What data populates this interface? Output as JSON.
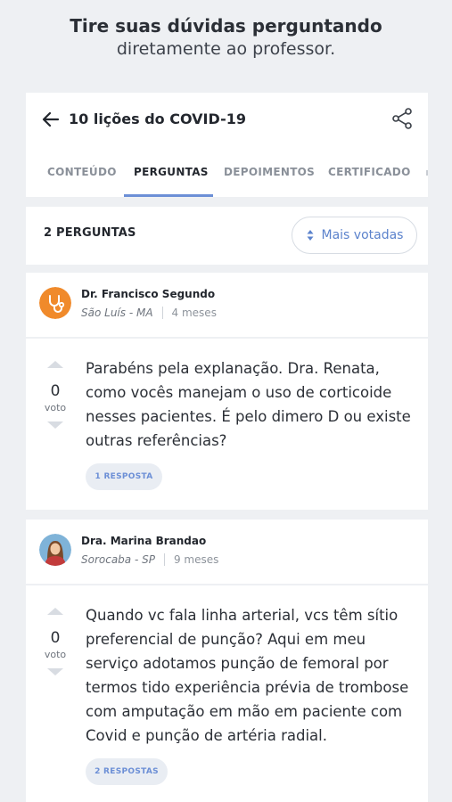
{
  "promo": {
    "title": "Tire suas dúvidas perguntando",
    "subtitle": "diretamente ao professor."
  },
  "header": {
    "course_title": "10 lições do COVID-19",
    "tabs": [
      {
        "label": "CONTEÚDO",
        "active": false
      },
      {
        "label": "PERGUNTAS",
        "active": true
      },
      {
        "label": "DEPOIMENTOS",
        "active": false
      },
      {
        "label": "CERTIFICADO",
        "active": false
      }
    ]
  },
  "filter": {
    "count_label": "2 PERGUNTAS",
    "sort_label": "Mais votadas"
  },
  "questions": [
    {
      "author": "Dr. Francisco Segundo",
      "location": "São Luís - MA",
      "time": "4 meses",
      "votes": "0",
      "vote_label": "voto",
      "text": "Parabéns pela explanação. Dra. Renata, como vocês manejam o uso de corticoide nesses pacientes. É pelo dimero D ou existe outras referências?",
      "replies_label": "1 RESPOSTA",
      "avatar_color": "#f08a2b"
    },
    {
      "author": "Dra. Marina Brandao",
      "location": "Sorocaba - SP",
      "time": "9 meses",
      "votes": "0",
      "vote_label": "voto",
      "text": "Quando vc fala linha arterial, vcs têm sítio preferencial de punção? Aqui em meu serviço adotamos punção de femoral por termos tido experiência prévia de trombose com amputação em mão em paciente com Covid e punção de artéria radial.",
      "replies_label": "2 RESPOSTAS"
    }
  ],
  "colors": {
    "accent": "#6c8fd6",
    "background": "#eef0f3",
    "card": "#ffffff"
  }
}
